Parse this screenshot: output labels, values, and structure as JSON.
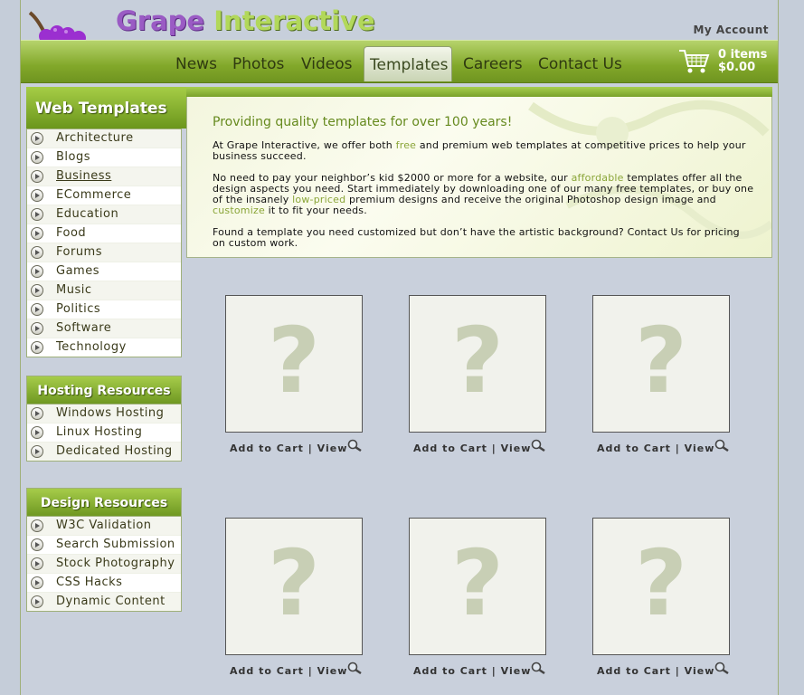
{
  "header": {
    "logo_part1": "Grape",
    "logo_part2": "Interactive",
    "my_account": "My Account"
  },
  "nav": {
    "items": [
      "News",
      "Photos",
      "Videos",
      "Templates",
      "Careers",
      "Contact Us"
    ],
    "active": "Templates"
  },
  "cart": {
    "items": "0 items",
    "total": "$0.00"
  },
  "sidebar": {
    "title": "Web Templates",
    "categories": [
      "Architecture",
      "Blogs",
      "Business",
      "ECommerce",
      "Education",
      "Food",
      "Forums",
      "Games",
      "Music",
      "Politics",
      "Software",
      "Technology"
    ],
    "hosting_title": "Hosting Resources",
    "hosting": [
      "Windows Hosting",
      "Linux Hosting",
      "Dedicated Hosting"
    ],
    "design_title": "Design Resources",
    "design": [
      "W3C Validation",
      "Search Submission",
      "Stock Photography",
      "CSS Hacks",
      "Dynamic Content"
    ]
  },
  "intro": {
    "heading": "Providing quality templates for over 100 years!",
    "p1a": "At Grape Interactive, we offer both ",
    "p1b": "free",
    "p1c": " and premium web templates at competitive prices to help your business succeed.",
    "p2a": "No need to pay your neighbor’s kid $2000 or more for a website, our ",
    "p2b": "affordable",
    "p2c": " templates offer all the design aspects you need.  Start immediately by downloading one of our many free templates, or buy one of the insanely ",
    "p2d": "low-priced",
    "p2e": " premium designs and receive the original Photoshop design image and ",
    "p2f": "customize",
    "p2g": " it to fit your needs.",
    "p3": "Found a template you need customized but don’t have the artistic background?  Contact Us for pricing on custom work."
  },
  "templates": {
    "placeholder": "?",
    "add_to_cart": "Add to Cart",
    "separator": "|",
    "view": "View"
  },
  "colors": {
    "accent_green": "#8ab536",
    "brand_purple": "#9a5bc4"
  }
}
